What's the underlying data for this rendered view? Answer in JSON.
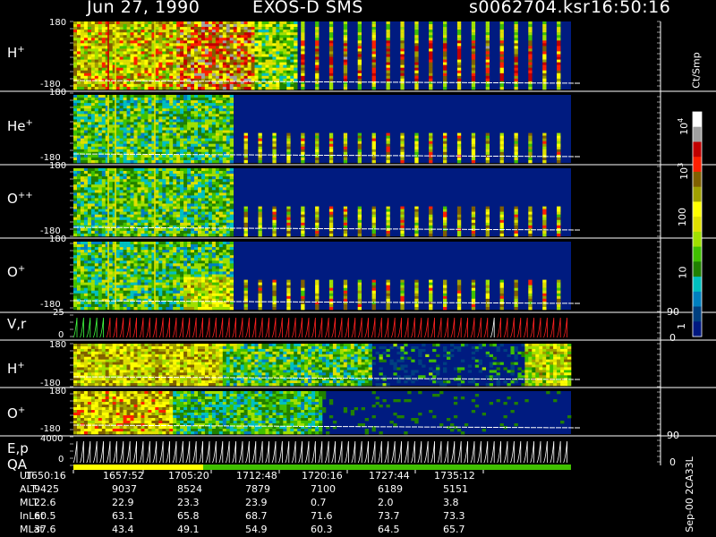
{
  "header": {
    "date": "Jun 27, 1990",
    "instrument": "EXOS-D SMS",
    "file": "s0062704.ksr",
    "time": "16:50:16"
  },
  "panels": [
    {
      "name": "H+",
      "label_base": "H",
      "label_sup": "+",
      "ymax": "180",
      "ymin": "-180"
    },
    {
      "name": "He+",
      "label_base": "He",
      "label_sup": "+",
      "ymax": "180",
      "ymin": "-180"
    },
    {
      "name": "O++",
      "label_base": "O",
      "label_sup": "++",
      "ymax": "180",
      "ymin": "-180"
    },
    {
      "name": "O+",
      "label_base": "O",
      "label_sup": "+",
      "ymax": "180",
      "ymin": "-180"
    },
    {
      "name": "V,r",
      "label_base": "V,r",
      "label_sup": "",
      "ymax": "25",
      "ymin": "0",
      "right_top": "90",
      "right_bottom": "0"
    },
    {
      "name": "H+ (lower)",
      "label_base": "H",
      "label_sup": "+",
      "ymax": "180",
      "ymin": "-180"
    },
    {
      "name": "O+ (lower)",
      "label_base": "O",
      "label_sup": "+",
      "ymax": "180",
      "ymin": "-180"
    },
    {
      "name": "E,p",
      "label_base": "E,p",
      "label_sup": "",
      "ymax": "4000",
      "ymin": "0",
      "right_top": "90",
      "right_bottom": "0"
    }
  ],
  "qa_label": "QA",
  "colorbar": {
    "title": "Ct/Smp",
    "ticks": [
      {
        "base": "10",
        "sup": "4",
        "value": 10000
      },
      {
        "base": "10",
        "sup": "3",
        "value": 1000
      },
      {
        "base": "100",
        "sup": "",
        "value": 100
      },
      {
        "base": "10",
        "sup": "",
        "value": 10
      },
      {
        "base": "1",
        "sup": "",
        "value": 1
      }
    ],
    "colors": [
      "#ffffff",
      "#a0a0a0",
      "#c00000",
      "#ff2000",
      "#806000",
      "#a0a000",
      "#ffff00",
      "#e0e000",
      "#a0e000",
      "#40c000",
      "#208000",
      "#00c0c0",
      "#0080c0",
      "#004080",
      "#001880"
    ]
  },
  "footer_stamp": "Sep-00  2CA33L",
  "orbit_table": {
    "rows": [
      {
        "label": "UT",
        "values": [
          "1650:16",
          "1657:52",
          "1705:20",
          "1712:48",
          "1720:16",
          "1727:44",
          "1735:12"
        ]
      },
      {
        "label": "ALT",
        "values": [
          "9425",
          "9037",
          "8524",
          "7879",
          "7100",
          "6189",
          "5151"
        ]
      },
      {
        "label": "MLT",
        "values": [
          "22.6",
          "22.9",
          "23.3",
          "23.9",
          "0.7",
          "2.0",
          "3.8"
        ]
      },
      {
        "label": "InLat",
        "values": [
          "60.5",
          "63.1",
          "65.8",
          "68.7",
          "71.6",
          "73.7",
          "73.3"
        ]
      },
      {
        "label": "MLat",
        "values": [
          "37.6",
          "43.4",
          "49.1",
          "54.9",
          "60.3",
          "64.5",
          "65.7"
        ]
      }
    ]
  },
  "chart_data": {
    "type": "heatmap",
    "title": "Jun 27, 1990   EXOS-D SMS   s0062704.ksr   16:50:16",
    "x_ticks": [
      "1650:16",
      "1657:52",
      "1705:20",
      "1712:48",
      "1720:16",
      "1727:44",
      "1735:12"
    ],
    "colorbar_label": "Ct/Smp",
    "colorbar_range": [
      1,
      10000
    ],
    "colorbar_scale": "log",
    "series": [
      {
        "name": "H+",
        "ylim": [
          -180,
          180
        ]
      },
      {
        "name": "He+",
        "ylim": [
          -180,
          180
        ]
      },
      {
        "name": "O++",
        "ylim": [
          -180,
          180
        ]
      },
      {
        "name": "O+",
        "ylim": [
          -180,
          180
        ]
      },
      {
        "name": "V,r",
        "ylim": [
          0,
          25
        ]
      },
      {
        "name": "H+",
        "ylim": [
          -180,
          180
        ]
      },
      {
        "name": "O+",
        "ylim": [
          -180,
          180
        ]
      },
      {
        "name": "E,p",
        "ylim": [
          0,
          4000
        ]
      }
    ]
  }
}
